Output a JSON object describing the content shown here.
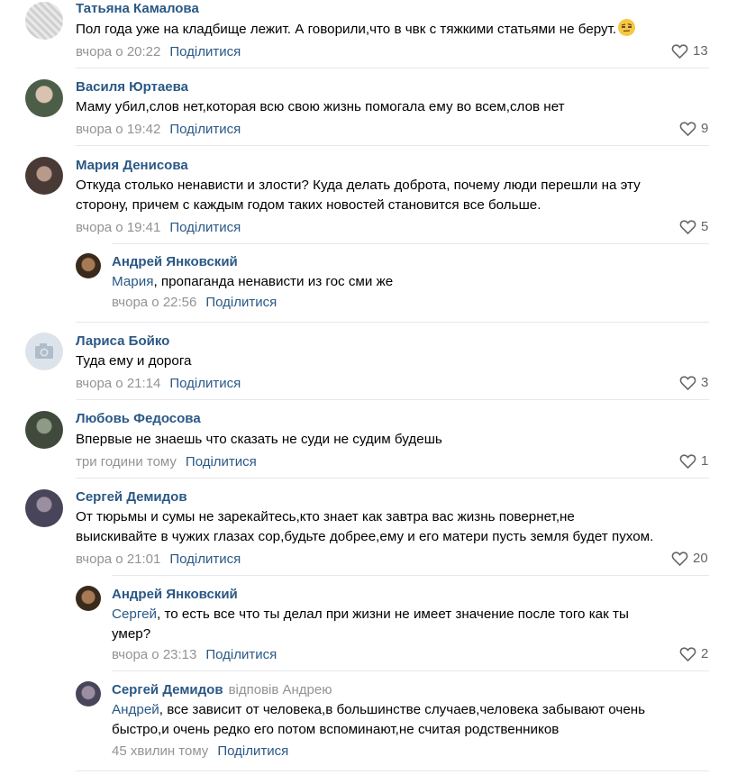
{
  "comments": [
    {
      "author": "Татьяна Камалова",
      "lines": [
        "Пол года уже на кладбище лежит. А говорили,что в чвк с тяжкими статьями не берут."
      ],
      "emoji_icon": "face-with-raised-eyebrow",
      "time": "вчора о 20:22",
      "share": "Поділитися",
      "likes": "13",
      "avatar_color": "#d9d9d9"
    },
    {
      "author": "Василя Юртаева",
      "lines": [
        "Маму убил,слов нет,которая всю свою жизнь помогала ему во всем,слов нет"
      ],
      "time": "вчора о 19:42",
      "share": "Поділитися",
      "likes": "9",
      "avatar_color": "#6e7f6a"
    },
    {
      "author": "Мария Денисова",
      "lines": [
        "Откуда столько ненависти и злости? Куда делать доброта, почему люди перешли на эту",
        "сторону, причем с каждым годом таких новостей становится все больше."
      ],
      "time": "вчора о 19:41",
      "share": "Поділитися",
      "likes": "5",
      "avatar_color": "#5c4a45"
    },
    {
      "author": "Андрей Янковский",
      "address": "Мария",
      "lines": [
        ", пропаганда ненависти из гос сми же"
      ],
      "time": "вчора о 22:56",
      "share": "Поділитися",
      "likes": "",
      "avatar_color": "#6b4a2e"
    },
    {
      "author": "Лариса Бойко",
      "lines": [
        "Туда ему и дорога"
      ],
      "time": "вчора о 21:14",
      "share": "Поділитися",
      "likes": "3",
      "avatar_icon": "camera-icon",
      "avatar_color": "#dde3ea"
    },
    {
      "author": "Любовь Федосова",
      "lines": [
        "Впервые не знаешь что сказать не суди не судим будешь"
      ],
      "time": "три години тому",
      "share": "Поділитися",
      "likes": "1",
      "avatar_color": "#556655"
    },
    {
      "author": "Сергей Демидов",
      "lines": [
        "От тюрьмы и сумы не зарекайтесь,кто знает как завтра вас жизнь повернет,не",
        "выискивайте в чужих глазах сор,будьте добрее,ему и его матери пусть земля будет пухом."
      ],
      "time": "вчора о 21:01",
      "share": "Поділитися",
      "likes": "20",
      "avatar_color": "#5d5a6e"
    },
    {
      "author": "Андрей Янковский",
      "address": "Сергей",
      "lines": [
        ", то есть все что ты делал при жизни не имеет значение после того как ты",
        "умер?"
      ],
      "time": "вчора о 23:13",
      "share": "Поділитися",
      "likes": "2",
      "avatar_color": "#6b4a2e"
    },
    {
      "author": "Сергей Демидов",
      "replied_to": "відповів Андрею",
      "address": "Андрей",
      "lines": [
        ", все зависит от человека,в большинстве случаев,человека забывают очень",
        "быстро,и очень редко его потом вспоминают,не считая родственников"
      ],
      "time": "45 хвилин тому",
      "share": "Поділитися",
      "likes": "",
      "avatar_color": "#5d5a6e"
    }
  ],
  "colors": {
    "link": "#2a5885",
    "meta": "#939393",
    "divider": "#e7e8ec"
  }
}
